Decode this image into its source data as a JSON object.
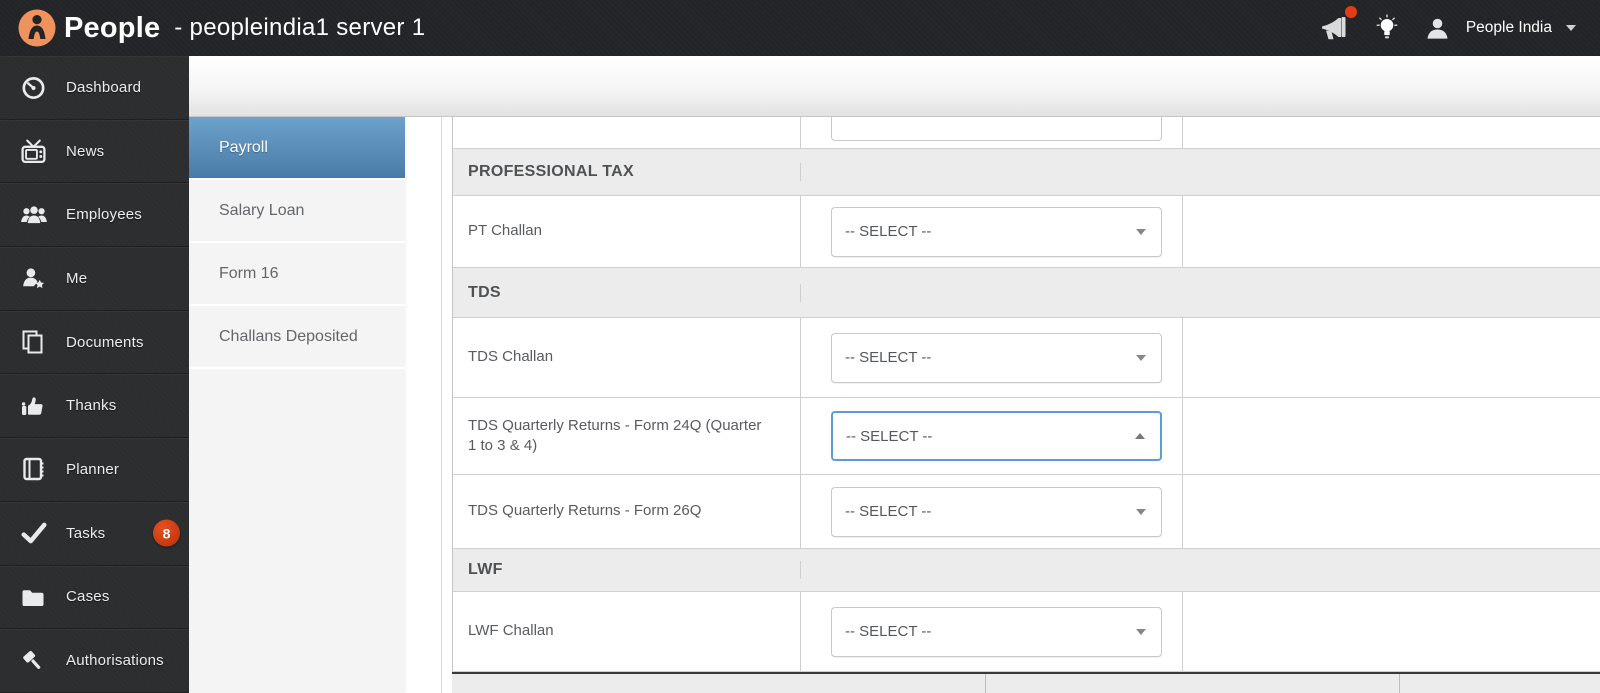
{
  "topbar": {
    "brand": "People",
    "server_label": "- peopleindia1 server 1",
    "user_name": "People India"
  },
  "sidebar": {
    "items": [
      {
        "label": "Dashboard",
        "icon": "dashboard-icon"
      },
      {
        "label": "News",
        "icon": "news-icon"
      },
      {
        "label": "Employees",
        "icon": "employees-icon"
      },
      {
        "label": "Me",
        "icon": "me-icon"
      },
      {
        "label": "Documents",
        "icon": "documents-icon"
      },
      {
        "label": "Thanks",
        "icon": "thanks-icon"
      },
      {
        "label": "Planner",
        "icon": "planner-icon"
      },
      {
        "label": "Tasks",
        "icon": "tasks-icon",
        "badge": "8"
      },
      {
        "label": "Cases",
        "icon": "cases-icon"
      },
      {
        "label": "Authorisations",
        "icon": "authorisations-icon"
      }
    ]
  },
  "submenu": {
    "items": [
      {
        "label": "Payroll",
        "active": true
      },
      {
        "label": "Salary Loan",
        "active": false
      },
      {
        "label": "Form 16",
        "active": false
      },
      {
        "label": "Challans Deposited",
        "active": false
      }
    ]
  },
  "form": {
    "select_placeholder": "-- SELECT --",
    "sections": [
      {
        "title": "PROFESSIONAL TAX",
        "fields": [
          {
            "label": "PT Challan"
          }
        ]
      },
      {
        "title": "TDS",
        "fields": [
          {
            "label": "TDS Challan"
          },
          {
            "label": "TDS Quarterly Returns - Form 24Q (Quarter 1 to 3 & 4)",
            "focused": true
          },
          {
            "label": "TDS Quarterly Returns - Form 26Q"
          }
        ]
      },
      {
        "title": "LWF",
        "fields": [
          {
            "label": "LWF Challan"
          }
        ]
      }
    ]
  },
  "colors": {
    "brand_orange": "#f0925d",
    "badge_red": "#cb3a13",
    "notification_red": "#e23d16",
    "active_menu_blue": "#5a8fba",
    "focus_border_blue": "#5e9dd0"
  }
}
